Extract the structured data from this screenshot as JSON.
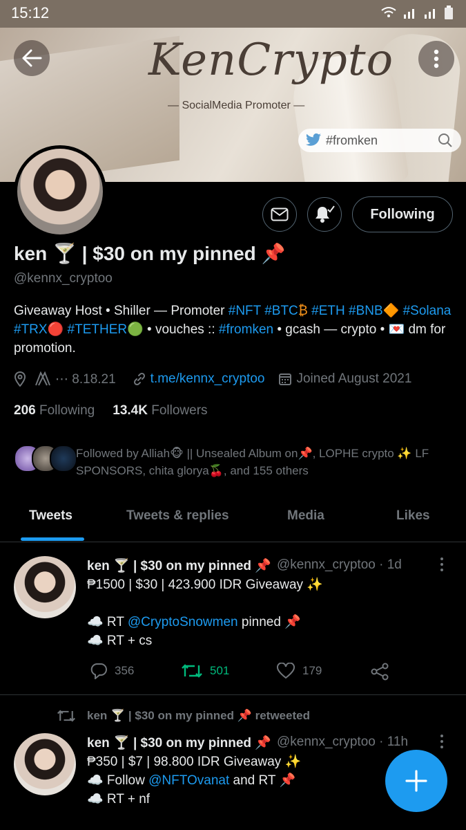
{
  "status_bar": {
    "time": "15:12"
  },
  "banner": {
    "title": "KenCrypto",
    "subtitle": "— SocialMedia Promoter —",
    "search_tag": "#fromken"
  },
  "profile": {
    "display_name": "ken 🍸 | $30 on my pinned 📌",
    "handle": "@kennx_cryptoo",
    "following_button": "Following",
    "bio": {
      "p1": "Giveaway Host • Shiller — Promoter ",
      "h_nft": "#NFT",
      "h_btc": "#BTC",
      "e_btc": "₿",
      "h_eth": "#ETH",
      "h_bnb": "#BNB",
      "e_bnb": "🔶",
      "h_sol": "#Solana",
      "h_trx": "#TRX",
      "e_trx": "🔴",
      "h_tether": "#TETHER",
      "e_tether": "🟢",
      "p2": " • vouches :: ",
      "h_fromken": "#fromken",
      "p3": " • gcash — crypto • ",
      "e_dm": "💌",
      "p4": " dm for promotion."
    },
    "meta": {
      "location": "⋯ 8.18.21",
      "link": "t.me/kennx_cryptoo",
      "joined": "Joined August 2021"
    },
    "following_count": "206",
    "following_label": "Following",
    "followers_count": "13.4K",
    "followers_label": "Followers",
    "followed_by": "Followed by Alliah🐵 || Unsealed Album on📌, LOPHE crypto ✨ LF SPONSORS, chita glorya🍒, and 155 others"
  },
  "tabs": [
    "Tweets",
    "Tweets & replies",
    "Media",
    "Likes"
  ],
  "tweets": [
    {
      "name": "ken 🍸 | $30 on my pinned 📌",
      "handle_time": "@kennx_cryptoo · 1d",
      "line1": "₱1500 | $30 | 423.900 IDR Giveaway ✨",
      "line2_pre": "☁️ RT ",
      "line2_link": "@CryptoSnowmen",
      "line2_post": " pinned 📌",
      "line3": "☁️ RT + cs",
      "replies": "356",
      "retweets": "501",
      "likes": "179"
    },
    {
      "retweeted_by": "ken 🍸 | $30 on my pinned 📌 retweeted",
      "name": "ken 🍸 | $30 on my pinned 📌",
      "handle_time": "@kennx_cryptoo · 11h",
      "line1": "₱350 | $7 | 98.800 IDR Giveaway ✨",
      "line2_pre": "☁️ Follow ",
      "line2_link": "@NFTOvanat",
      "line2_post": " and RT 📌",
      "line3": "☁️ RT + nf"
    }
  ],
  "colors": {
    "accent": "#1d9bf0",
    "retweet_green": "#00ba7c",
    "muted": "#71767b"
  }
}
